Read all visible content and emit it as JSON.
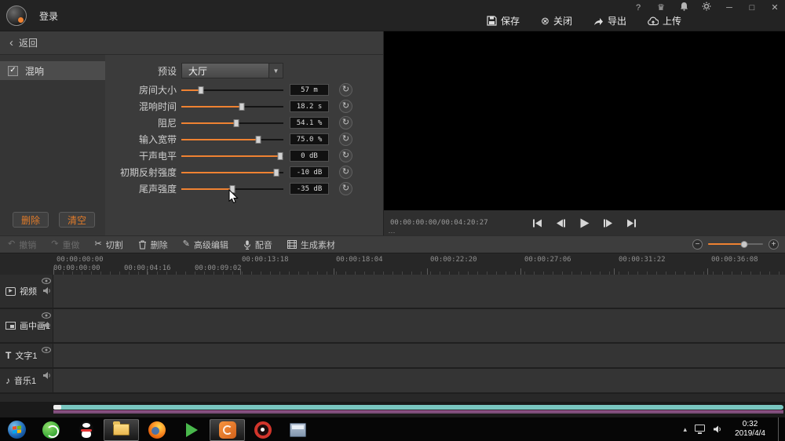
{
  "titlebar": {
    "login": "登录",
    "actions": [
      {
        "label": "保存"
      },
      {
        "label": "关闭"
      },
      {
        "label": "导出"
      },
      {
        "label": "上传"
      }
    ]
  },
  "panel": {
    "back": "返回",
    "reverb": "混响",
    "preset_label": "预设",
    "preset_value": "大厅",
    "sliders": [
      {
        "label": "房间大小",
        "value": "57 m",
        "fill": "19%"
      },
      {
        "label": "混响时间",
        "value": "18.2 s",
        "fill": "59%"
      },
      {
        "label": "阻尼",
        "value": "54.1 %",
        "fill": "54%"
      },
      {
        "label": "输入宽带",
        "value": "75.0 %",
        "fill": "75%"
      },
      {
        "label": "干声电平",
        "value": "0 dB",
        "fill": "97%"
      },
      {
        "label": "初期反射强度",
        "value": "-10 dB",
        "fill": "93%"
      },
      {
        "label": "尾声强度",
        "value": "-35 dB",
        "fill": "50%"
      }
    ],
    "delete": "删除",
    "clear": "清空"
  },
  "preview": {
    "timecode": "00:00:00:00/00:04:20:27"
  },
  "toolbar": {
    "undo": "撤销",
    "redo": "重做",
    "cut": "切割",
    "del": "删除",
    "advanced": "高级编辑",
    "dub": "配音",
    "generate": "生成素材",
    "zoom_fill": "65%"
  },
  "timeline": {
    "ruler_top": [
      "00:00:00:00",
      "00:00:13:18",
      "00:00:18:04",
      "00:00:22:20",
      "00:00:27:06",
      "00:00:31:22",
      "00:00:36:08"
    ],
    "ruler_bottom": [
      "00:00:00:00",
      "00:00:04:16",
      "00:00:09:02"
    ],
    "tracks": [
      {
        "label": "视频"
      },
      {
        "label": "画中画1"
      },
      {
        "label": "文字1"
      },
      {
        "label": "音乐1"
      }
    ]
  },
  "taskbar": {
    "time": "0:32",
    "date": "2019/4/4"
  },
  "icons": {
    "back": "‹",
    "check": "✓",
    "dropdown": "▼",
    "reset": "↻",
    "help": "?",
    "crown": "♛",
    "minimize": "─",
    "maximize": "□",
    "close": "✕",
    "close_app": "⊗",
    "undo": "↶",
    "redo": "↷",
    "cut": "✂",
    "edit": "✎",
    "note": "♪",
    "play": "▶",
    "t": "T",
    "minus": "−",
    "plus": "+",
    "tray_up": "▴",
    "splitter": "⋯"
  },
  "colors": {
    "accent": "#ef8232",
    "scrollbar_teal": "#79c6c0",
    "scrollbar_purple": "#7c4e79"
  }
}
